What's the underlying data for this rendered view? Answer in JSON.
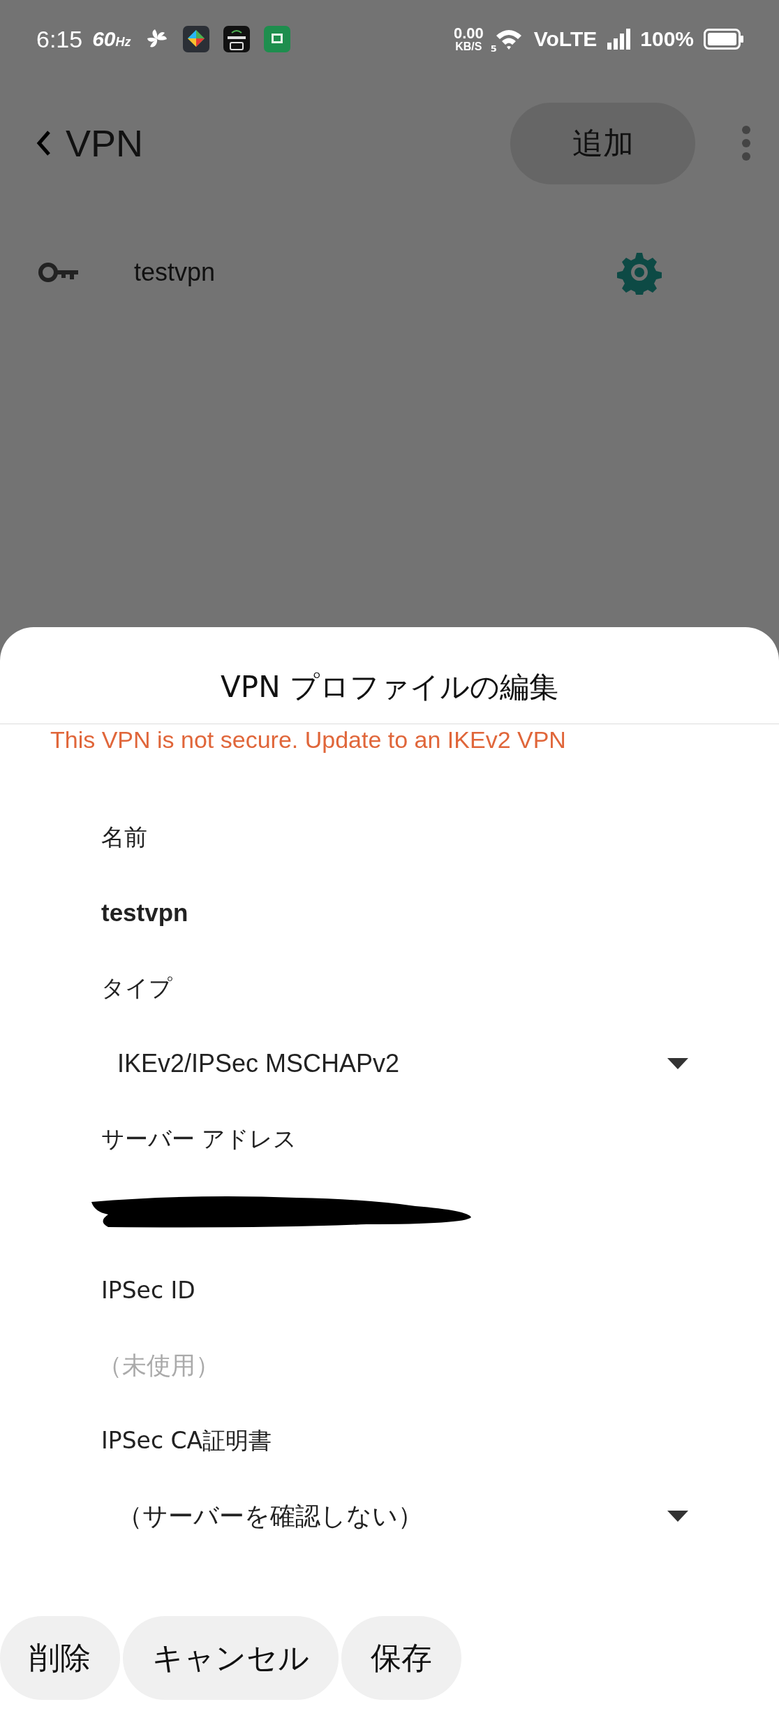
{
  "status_bar": {
    "time": "6:15",
    "refresh_rate": "60",
    "refresh_unit": "Hz",
    "net_speed": "0.00",
    "net_unit": "KB/S",
    "wifi_badge": "5",
    "network": "VoLTE",
    "battery": "100%"
  },
  "app_bar": {
    "title": "VPN",
    "add_button": "追加"
  },
  "vpn_list": [
    {
      "name": "testvpn"
    }
  ],
  "dialog": {
    "title": "VPN プロファイルの編集",
    "warning": "This VPN is not secure. Update to an IKEv2 VPN",
    "fields": [
      {
        "label": "名前",
        "kind": "text",
        "value": "testvpn"
      },
      {
        "label": "タイプ",
        "kind": "dropdown",
        "value": "IKEv2/IPSec MSCHAPv2"
      },
      {
        "label": "サーバー アドレス",
        "kind": "redacted"
      },
      {
        "label": "IPSec ID",
        "kind": "text",
        "placeholder": "（未使用）"
      },
      {
        "label": "IPSec CA証明書",
        "kind": "dropdown",
        "value": "（サーバーを確認しない）"
      }
    ],
    "buttons": [
      "削除",
      "キャンセル",
      "保存"
    ]
  }
}
